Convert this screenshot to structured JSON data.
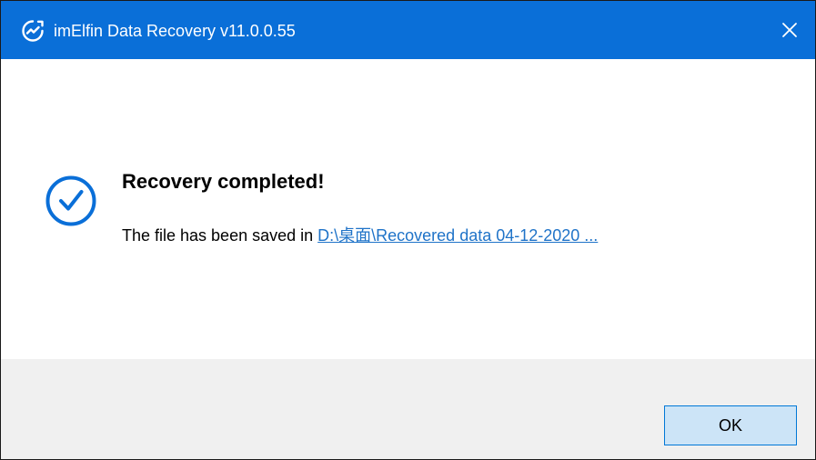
{
  "window": {
    "title": "imElfin Data Recovery v11.0.0.55",
    "close_symbol": "✕",
    "titlebar_color": "#0a6fd8",
    "app_icon": "refresh-chart-icon"
  },
  "dialog": {
    "status_icon": "check-circle-icon",
    "heading": "Recovery completed!",
    "message_prefix": "The file has been saved in ",
    "saved_path": "D:\\桌面\\Recovered data 04-12-2020 ...",
    "link_color": "#1f73c8",
    "accent_color": "#0a6fd8"
  },
  "footer": {
    "ok_label": "OK"
  }
}
